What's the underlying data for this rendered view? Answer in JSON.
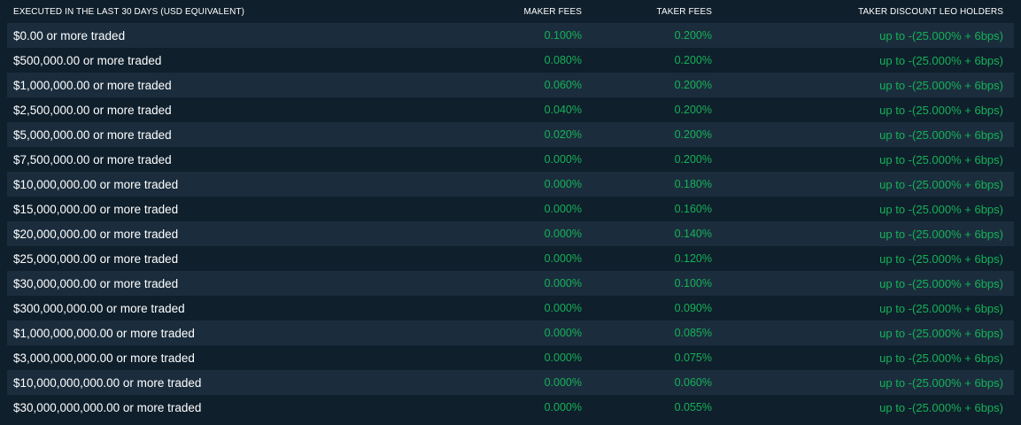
{
  "header": {
    "volume": "EXECUTED IN THE LAST 30 DAYS (USD EQUIVALENT)",
    "maker": "MAKER FEES",
    "taker": "TAKER FEES",
    "leo": "TAKER DISCOUNT LEO HOLDERS"
  },
  "colors": {
    "background": "#0f1f2c",
    "row_alt": "#1b2d3d",
    "text": "#ffffff",
    "fee_green": "#16b157"
  },
  "rows": [
    {
      "volume": "$0.00 or more traded",
      "maker": "0.100%",
      "taker": "0.200%",
      "leo": "up to -(25.000% + 6bps)"
    },
    {
      "volume": "$500,000.00 or more traded",
      "maker": "0.080%",
      "taker": "0.200%",
      "leo": "up to -(25.000% + 6bps)"
    },
    {
      "volume": "$1,000,000.00 or more traded",
      "maker": "0.060%",
      "taker": "0.200%",
      "leo": "up to -(25.000% + 6bps)"
    },
    {
      "volume": "$2,500,000.00 or more traded",
      "maker": "0.040%",
      "taker": "0.200%",
      "leo": "up to -(25.000% + 6bps)"
    },
    {
      "volume": "$5,000,000.00 or more traded",
      "maker": "0.020%",
      "taker": "0.200%",
      "leo": "up to -(25.000% + 6bps)"
    },
    {
      "volume": "$7,500,000.00 or more traded",
      "maker": "0.000%",
      "taker": "0.200%",
      "leo": "up to -(25.000% + 6bps)"
    },
    {
      "volume": "$10,000,000.00 or more traded",
      "maker": "0.000%",
      "taker": "0.180%",
      "leo": "up to -(25.000% + 6bps)"
    },
    {
      "volume": "$15,000,000.00 or more traded",
      "maker": "0.000%",
      "taker": "0.160%",
      "leo": "up to -(25.000% + 6bps)"
    },
    {
      "volume": "$20,000,000.00 or more traded",
      "maker": "0.000%",
      "taker": "0.140%",
      "leo": "up to -(25.000% + 6bps)"
    },
    {
      "volume": "$25,000,000.00 or more traded",
      "maker": "0.000%",
      "taker": "0.120%",
      "leo": "up to -(25.000% + 6bps)"
    },
    {
      "volume": "$30,000,000.00 or more traded",
      "maker": "0.000%",
      "taker": "0.100%",
      "leo": "up to -(25.000% + 6bps)"
    },
    {
      "volume": "$300,000,000.00 or more traded",
      "maker": "0.000%",
      "taker": "0.090%",
      "leo": "up to -(25.000% + 6bps)"
    },
    {
      "volume": "$1,000,000,000.00 or more traded",
      "maker": "0.000%",
      "taker": "0.085%",
      "leo": "up to -(25.000% + 6bps)"
    },
    {
      "volume": "$3,000,000,000.00 or more traded",
      "maker": "0.000%",
      "taker": "0.075%",
      "leo": "up to -(25.000% + 6bps)"
    },
    {
      "volume": "$10,000,000,000.00 or more traded",
      "maker": "0.000%",
      "taker": "0.060%",
      "leo": "up to -(25.000% + 6bps)"
    },
    {
      "volume": "$30,000,000,000.00 or more traded",
      "maker": "0.000%",
      "taker": "0.055%",
      "leo": "up to -(25.000% + 6bps)"
    }
  ]
}
